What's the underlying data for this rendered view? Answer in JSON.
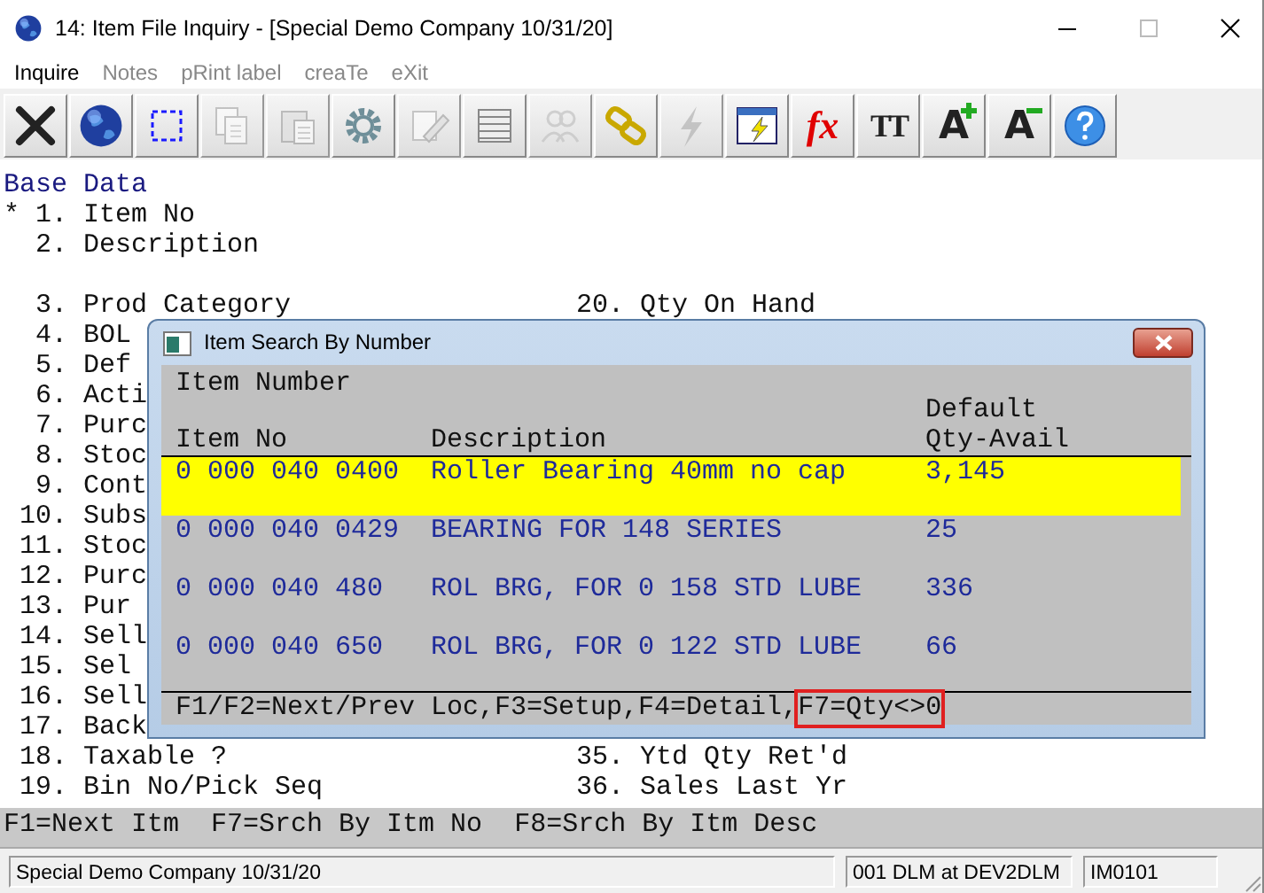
{
  "window": {
    "title": "14: Item File Inquiry - [Special Demo Company 10/31/20]"
  },
  "menu": [
    {
      "label": "Inquire",
      "disabled": false
    },
    {
      "label": "Notes",
      "disabled": true
    },
    {
      "label": "pRint label",
      "disabled": true
    },
    {
      "label": "creaTe",
      "disabled": true
    },
    {
      "label": "eXit",
      "disabled": true
    }
  ],
  "toolbar": [
    {
      "kind": "close",
      "disabled": false
    },
    {
      "kind": "globe",
      "disabled": false
    },
    {
      "kind": "select",
      "disabled": false
    },
    {
      "kind": "copy",
      "disabled": true
    },
    {
      "kind": "paste",
      "disabled": true
    },
    {
      "kind": "gear",
      "disabled": false
    },
    {
      "kind": "edit",
      "disabled": true
    },
    {
      "kind": "list",
      "disabled": false
    },
    {
      "kind": "people",
      "disabled": true
    },
    {
      "kind": "chain",
      "disabled": false
    },
    {
      "kind": "bolt",
      "disabled": true
    },
    {
      "kind": "window-bolt",
      "disabled": false
    },
    {
      "kind": "fx",
      "glyph": "fx",
      "disabled": false
    },
    {
      "kind": "tt",
      "glyph": "TT",
      "disabled": false
    },
    {
      "kind": "bigger",
      "glyph": "A",
      "disabled": false
    },
    {
      "kind": "smaller",
      "glyph": "A",
      "disabled": false
    },
    {
      "kind": "help",
      "disabled": false
    }
  ],
  "form": {
    "title": "Base Data",
    "groups": [
      {
        "fields": [
          {
            "marker": "*",
            "number": "1.",
            "label": "Item No"
          },
          {
            "number": "2.",
            "label": "Description"
          }
        ]
      },
      {
        "fields": [
          {
            "number": "3.",
            "label": "Prod Category",
            "right": {
              "number": "20.",
              "label": "Qty On Hand"
            }
          },
          {
            "number": "4.",
            "label": "BOL"
          },
          {
            "number": "5.",
            "label": "Def"
          },
          {
            "number": "6.",
            "label": "Acti"
          },
          {
            "number": "7.",
            "label": "Purc"
          },
          {
            "number": "8.",
            "label": "Stoc"
          },
          {
            "number": "9.",
            "label": "Cont"
          },
          {
            "number": "10.",
            "label": "Subs"
          },
          {
            "number": "11.",
            "label": "Stoc"
          },
          {
            "number": "12.",
            "label": "Purc"
          },
          {
            "number": "13.",
            "label": "Pur"
          },
          {
            "number": "14.",
            "label": "Sell"
          },
          {
            "number": "15.",
            "label": "Sel"
          },
          {
            "number": "16.",
            "label": "Sell"
          },
          {
            "number": "17.",
            "label": "Back"
          },
          {
            "number": "18.",
            "label": "Taxable ?",
            "right": {
              "number": "35.",
              "label": "Ytd Qty Ret'd"
            }
          },
          {
            "number": "19.",
            "label": "Bin No/Pick Seq",
            "right": {
              "number": "36.",
              "label": "Sales Last Yr"
            }
          }
        ]
      }
    ]
  },
  "dialog": {
    "title": "Item Search By Number",
    "heading": "Item Number",
    "columns": [
      {
        "label": "Item No"
      },
      {
        "label": "Description"
      },
      {
        "label": "Default Qty-Avail"
      }
    ],
    "rows": [
      {
        "selected": true,
        "cells": [
          "0 000 040 0400",
          "Roller Bearing 40mm no cap",
          "3,145"
        ]
      },
      {
        "selected": false,
        "cells": [
          "0 000 040 0429",
          "BEARING FOR 148 SERIES",
          "25"
        ]
      },
      {
        "selected": false,
        "cells": [
          "0 000 040 480",
          "ROL BRG, FOR 0 158 STD LUBE",
          "336"
        ]
      },
      {
        "selected": false,
        "cells": [
          "0 000 040 650",
          "ROL BRG, FOR 0 122 STD LUBE",
          "66"
        ]
      }
    ],
    "footer": [
      {
        "text": "F1/F2=Next/Prev Loc,F3=Setup,F4=Detail,",
        "highlighted": false
      },
      {
        "text": "F7=Qty<>0",
        "highlighted": true
      }
    ]
  },
  "function_keys": [
    "F1=Next Itm",
    "F7=Srch By Itm No",
    "F8=Srch By Itm Desc"
  ],
  "status_bar": [
    "Special Demo Company 10/31/20",
    "001 DLM at DEV2DLM",
    "IM0101"
  ]
}
